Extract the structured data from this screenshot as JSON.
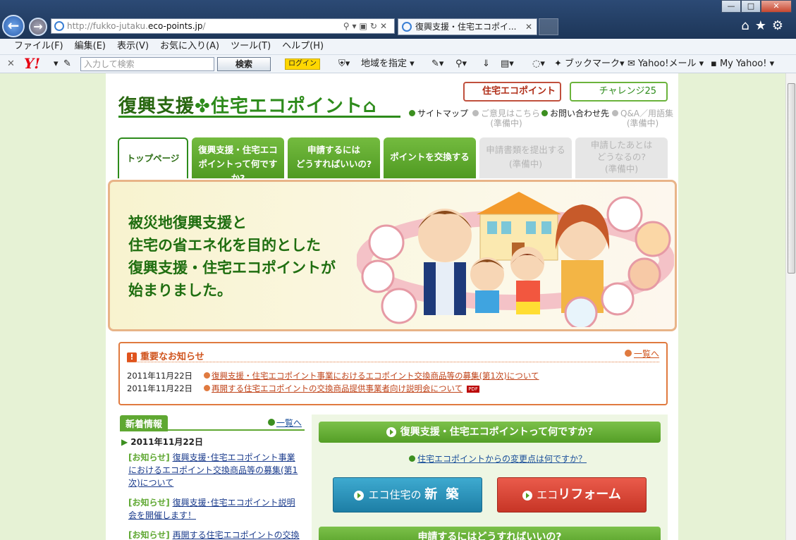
{
  "browser": {
    "url_prefix": "http://fukko-jutaku.",
    "url_domain": "eco-points.jp",
    "url_suffix": "/",
    "tab_title": "復興支援・住宅エコポイ...",
    "window_controls": [
      "—",
      "□",
      "✕"
    ],
    "menu": [
      "ファイル(F)",
      "編集(E)",
      "表示(V)",
      "お気に入り(A)",
      "ツール(T)",
      "ヘルプ(H)"
    ]
  },
  "yahoo_toolbar": {
    "logo": "Y!",
    "search_placeholder": "入力して検索",
    "search_button": "検索",
    "login": "ログイン",
    "region": "地域を指定",
    "bookmark": "ブックマーク",
    "mail": "Yahoo!メール",
    "myyahoo": "My Yahoo!"
  },
  "site": {
    "logo_a": "復興支援",
    "logo_b": "住宅エコポイント",
    "btn_eco": "住宅エコポイント",
    "btn_challenge": "チャレンジ25",
    "util_links": [
      {
        "label": "サイトマップ",
        "sub": ""
      },
      {
        "label": "ご意見はこちら",
        "sub": "(準備中)"
      },
      {
        "label": "お問い合わせ先",
        "sub": ""
      },
      {
        "label": "Q&A／用語集",
        "sub": "(準備中)"
      }
    ],
    "gnav": [
      {
        "l1": "トップページ",
        "l2": ""
      },
      {
        "l1": "復興支援・住宅エコ",
        "l2": "ポイントって何ですか?"
      },
      {
        "l1": "申請するには",
        "l2": "どうすればいいの?"
      },
      {
        "l1": "ポイントを交換する",
        "l2": ""
      },
      {
        "l1": "申請書類を提出する",
        "l2": "(準備中)"
      },
      {
        "l1": "申請したあとは",
        "l2": "どうなるの?",
        "l3": "(準備中)"
      }
    ],
    "hero": {
      "lines": [
        "被災地復興支援と",
        "住宅の省エネ化を目的とした",
        "復興支援・住宅エコポイントが",
        "始まりました。"
      ]
    },
    "important": {
      "title": "重要なお知らせ",
      "more": "一覧へ",
      "items": [
        {
          "date": "2011年11月22日",
          "text": "復興支援・住宅エコポイント事業におけるエコポイント交換商品等の募集(第1次)について"
        },
        {
          "date": "2011年11月22日",
          "text": "再開する住宅エコポイントの交換商品提供事業者向け説明会について",
          "pdf": "PDF"
        }
      ]
    },
    "whats_new": {
      "title": "新着情報",
      "more": "一覧へ",
      "date": "2011年11月22日",
      "items": [
        {
          "tag": "[お知らせ]",
          "text": "復興支援･住宅エコポイント事業におけるエコポイント交換商品等の募集(第1次)について"
        },
        {
          "tag": "[お知らせ]",
          "text": "復興支援･住宅エコポイント説明会を開催します！"
        },
        {
          "tag": "[お知らせ]",
          "text": "再開する住宅エコポイントの交換商"
        }
      ]
    },
    "right": {
      "what": "復興支援・住宅エコポイントって何ですか?",
      "change_link": "住宅エコポイントからの変更点は何ですか？",
      "new_pre": "エコ住宅の",
      "new_main": "新 築",
      "reform_pre": "エコ",
      "reform_main": "リフォーム",
      "how": "申請するにはどうすればいいの?"
    }
  }
}
